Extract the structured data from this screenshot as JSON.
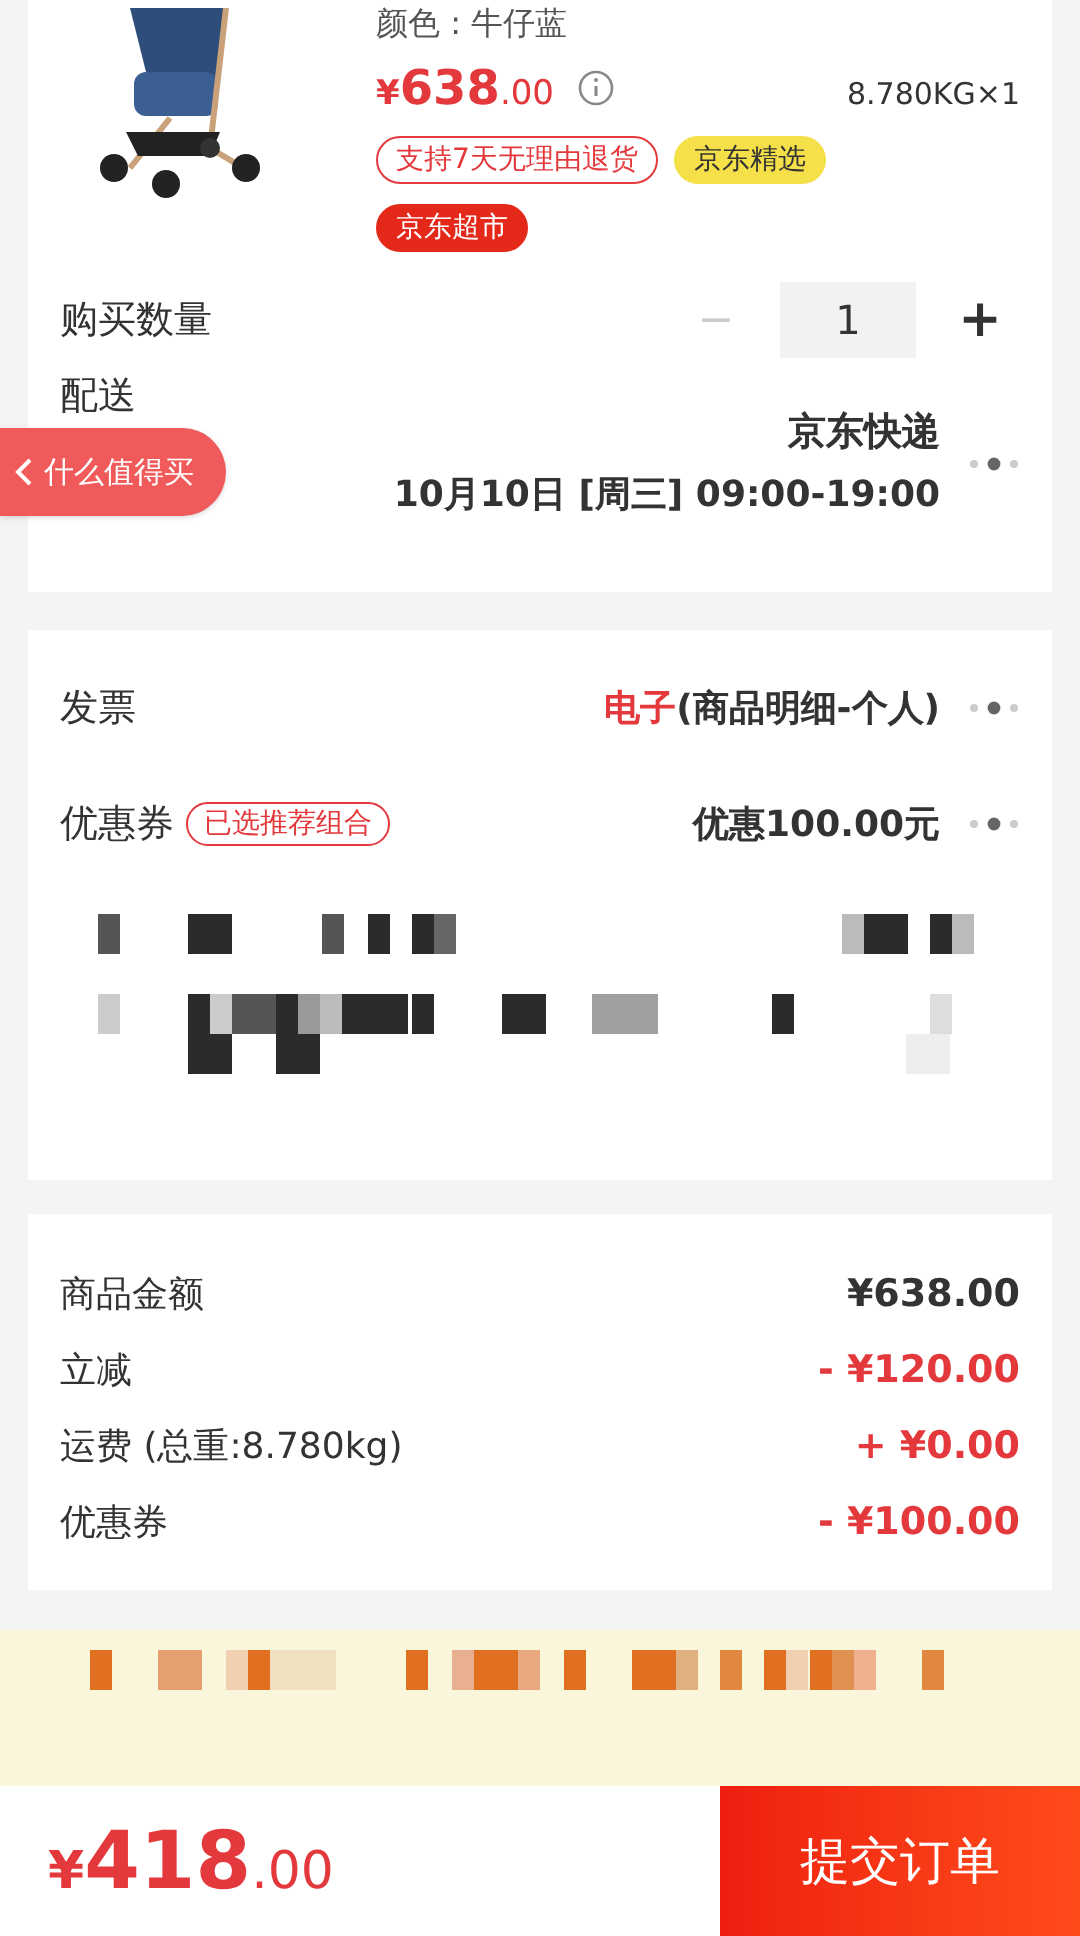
{
  "product": {
    "color_label": "颜色 : 牛仔蓝",
    "price": {
      "symbol": "¥",
      "integer": "638",
      "decimal": ".00"
    },
    "weight_qty": "8.780KG×1",
    "tags": [
      {
        "label": "支持7天无理由退货",
        "kind": "outline"
      },
      {
        "label": "京东精选",
        "kind": "yellow"
      },
      {
        "label": "京东超市",
        "kind": "red"
      }
    ]
  },
  "quantity": {
    "label": "购买数量",
    "minus": "−",
    "value": "1",
    "plus": "+",
    "minus_disabled": true
  },
  "delivery": {
    "label": "配送",
    "carrier": "京东快递",
    "time": "10月10日 [周三] 09:00-19:00"
  },
  "float_button": {
    "label": "什么值得买"
  },
  "invoice": {
    "label": "发票",
    "type": "电子",
    "detail": "(商品明细-个人)"
  },
  "coupon": {
    "label": "优惠券",
    "badge": "已选推荐组合",
    "value": "优惠100.00元"
  },
  "summary": [
    {
      "label": "商品金额",
      "value": "¥638.00",
      "kind": "plain"
    },
    {
      "label": "立减",
      "value": "- ¥120.00",
      "kind": "red"
    },
    {
      "label": "运费 (总重:8.780kg)",
      "value": "+ ¥0.00",
      "kind": "red"
    },
    {
      "label": "优惠券",
      "value": "- ¥100.00",
      "kind": "red"
    }
  ],
  "footer": {
    "total": {
      "symbol": "¥",
      "integer": "418",
      "decimal": ".00"
    },
    "submit": "提交订单"
  }
}
